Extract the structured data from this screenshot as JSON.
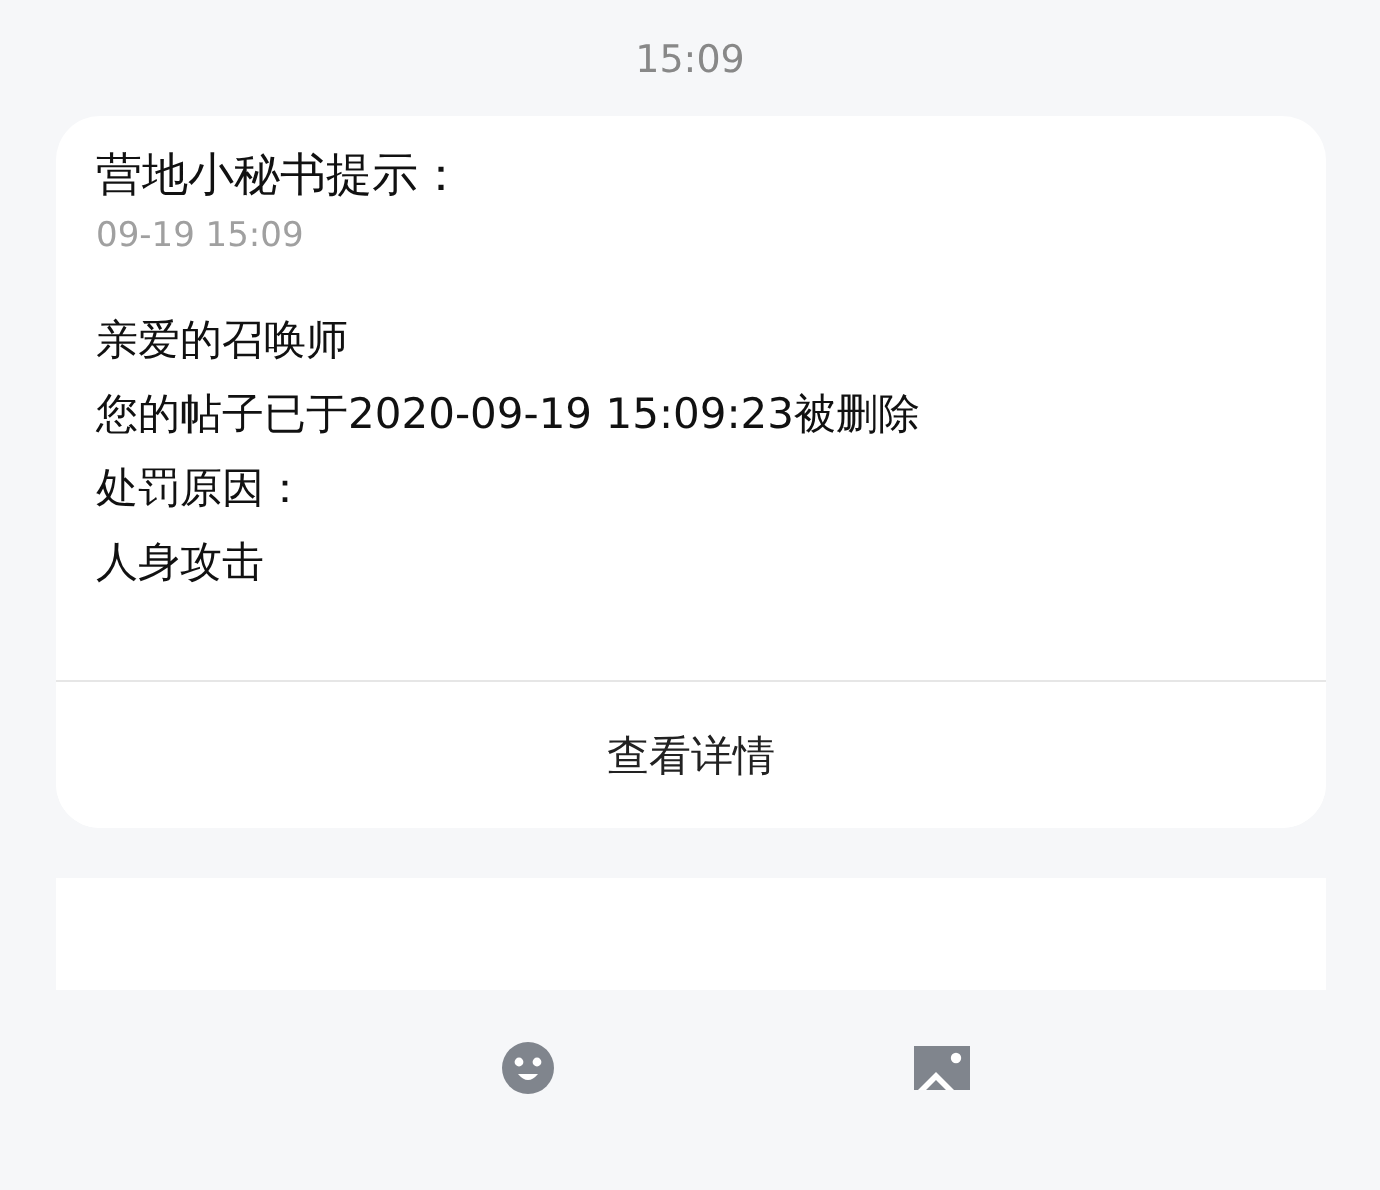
{
  "timestamp": "15:09",
  "message": {
    "title": "营地小秘书提示：",
    "date": "09-19 15:09",
    "lines": [
      "亲爱的召唤师",
      "您的帖子已于2020-09-19 15:09:23被删除",
      "处罚原因：",
      "人身攻击"
    ],
    "action": "查看详情"
  },
  "composer": {
    "kind": "text"
  }
}
